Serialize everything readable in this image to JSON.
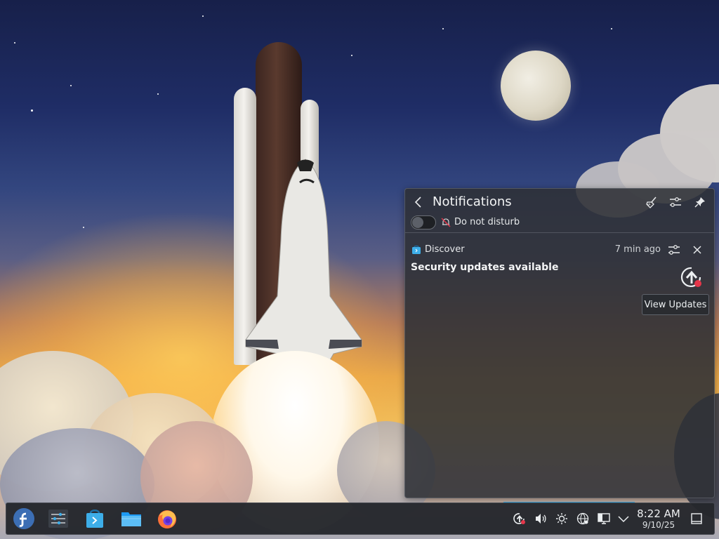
{
  "notifications": {
    "title": "Notifications",
    "dnd_label": "Do not disturb",
    "item": {
      "app_name": "Discover",
      "time": "7 min ago",
      "title": "Security updates available",
      "action_label": "View Updates"
    }
  },
  "taskbar": {
    "apps": [
      "fedora-launcher-icon",
      "system-settings-icon",
      "discover-store-icon",
      "file-manager-icon",
      "firefox-icon"
    ],
    "tray": [
      "updates-icon",
      "volume-icon",
      "brightness-icon",
      "network-icon",
      "display-icon",
      "expand-tray-icon"
    ],
    "clock_time": "8:22 AM",
    "clock_date": "9/10/25"
  },
  "colors": {
    "accent": "#3daee9",
    "badge": "#e5364a",
    "panel_bg": "#2d3036"
  }
}
